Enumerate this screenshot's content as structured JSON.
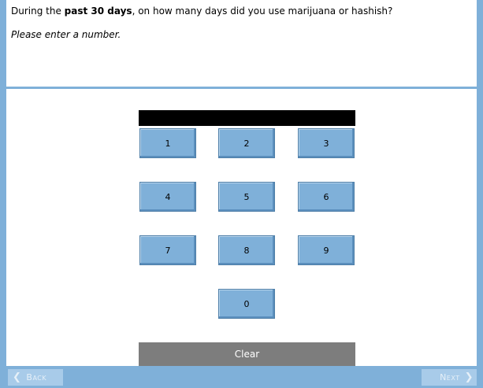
{
  "question": {
    "prefix": "During the ",
    "bold": "past 30 days",
    "suffix": ", on how many days did you use marijuana or hashish?",
    "instruction": "Please enter a number."
  },
  "keypad": {
    "display_value": "",
    "keys": [
      "1",
      "2",
      "3",
      "4",
      "5",
      "6",
      "7",
      "8",
      "9",
      "0"
    ],
    "clear_label": "Clear"
  },
  "nav": {
    "back_label": "Back",
    "next_label": "Next"
  },
  "colors": {
    "accent": "#7fb0d9",
    "key_fill": "#7fb0d9",
    "clear_fill": "#7d7d7d",
    "display_fill": "#000000"
  },
  "icons": {
    "back": "chevron-left-icon",
    "next": "chevron-right-icon"
  }
}
